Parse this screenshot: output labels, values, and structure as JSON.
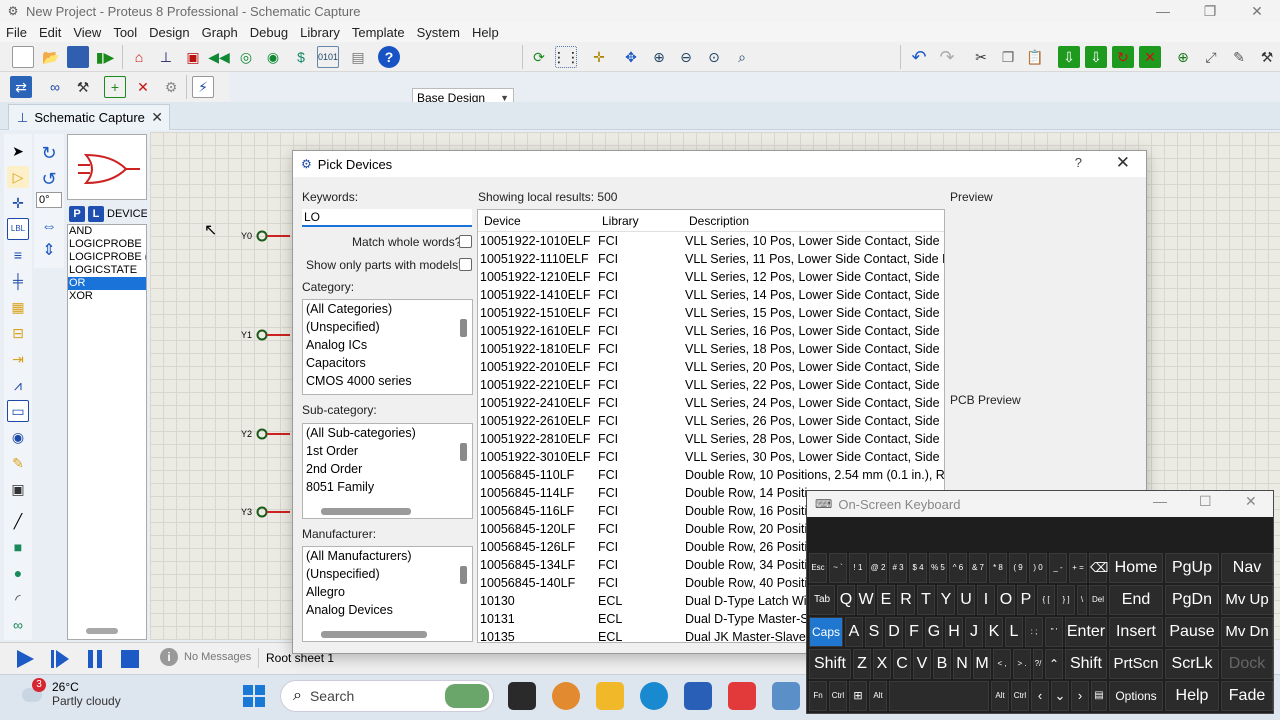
{
  "window": {
    "title": "New Project - Proteus 8 Professional - Schematic Capture"
  },
  "menu": [
    "File",
    "Edit",
    "View",
    "Tool",
    "Design",
    "Graph",
    "Debug",
    "Library",
    "Template",
    "System",
    "Help"
  ],
  "toolbar": {
    "design_select": "Base Design"
  },
  "tab": {
    "label": "Schematic Capture"
  },
  "device_panel": {
    "rotation_value": "0°",
    "header_p": "P",
    "header_l": "L",
    "header_label": "DEVICES",
    "items": [
      "AND",
      "LOGICPROBE",
      "LOGICPROBE (",
      "LOGICSTATE",
      "OR",
      "XOR"
    ],
    "selected_index": 4
  },
  "canvas": {
    "pins": [
      "Y0",
      "Y1",
      "Y2",
      "Y3"
    ]
  },
  "status": {
    "messages": "No Messages",
    "sheet": "Root sheet 1"
  },
  "taskbar": {
    "weather_badge": "3",
    "temperature": "26°C",
    "condition": "Partly cloudy",
    "search_placeholder": "Search"
  },
  "dialog": {
    "title": "Pick Devices",
    "help": "?",
    "keywords_label": "Keywords:",
    "keywords_value": "LO",
    "match_whole_words": "Match whole words?",
    "only_models": "Show only parts with models?",
    "category_label": "Category:",
    "categories": [
      "(All Categories)",
      "(Unspecified)",
      "Analog ICs",
      "Capacitors",
      "CMOS 4000 series"
    ],
    "subcategory_label": "Sub-category:",
    "subcategories": [
      "(All Sub-categories)",
      "1st Order",
      "2nd Order",
      "8051 Family"
    ],
    "manufacturer_label": "Manufacturer:",
    "manufacturers": [
      "(All Manufacturers)",
      "(Unspecified)",
      "Allegro",
      "Analog Devices"
    ],
    "results_label": "Showing local results: 500",
    "columns": [
      "Device",
      "Library",
      "Description"
    ],
    "rows": [
      [
        "10051922-1010ELF",
        "FCI",
        "VLL Series, 10 Pos, Lower Side Contact, Side Ent"
      ],
      [
        "10051922-1110ELF",
        "FCI",
        "VLL Series, 11 Pos, Lower Side Contact, Side Ent"
      ],
      [
        "10051922-1210ELF",
        "FCI",
        "VLL Series, 12 Pos, Lower Side Contact, Side Ent"
      ],
      [
        "10051922-1410ELF",
        "FCI",
        "VLL Series, 14 Pos, Lower Side Contact, Side Ent"
      ],
      [
        "10051922-1510ELF",
        "FCI",
        "VLL Series, 15 Pos, Lower Side Contact, Side Ent"
      ],
      [
        "10051922-1610ELF",
        "FCI",
        "VLL Series, 16 Pos, Lower Side Contact, Side Ent"
      ],
      [
        "10051922-1810ELF",
        "FCI",
        "VLL Series, 18 Pos, Lower Side Contact, Side Ent"
      ],
      [
        "10051922-2010ELF",
        "FCI",
        "VLL Series, 20 Pos, Lower Side Contact, Side Ent"
      ],
      [
        "10051922-2210ELF",
        "FCI",
        "VLL Series, 22 Pos, Lower Side Contact, Side Ent"
      ],
      [
        "10051922-2410ELF",
        "FCI",
        "VLL Series, 24 Pos, Lower Side Contact, Side Ent"
      ],
      [
        "10051922-2610ELF",
        "FCI",
        "VLL Series, 26 Pos, Lower Side Contact, Side Ent"
      ],
      [
        "10051922-2810ELF",
        "FCI",
        "VLL Series, 28 Pos, Lower Side Contact, Side Ent"
      ],
      [
        "10051922-3010ELF",
        "FCI",
        "VLL Series, 30 Pos, Lower Side Contact, Side Ent"
      ],
      [
        "10056845-110LF",
        "FCI",
        "Double Row, 10 Positions, 2.54 mm (0.1 in.), Rig"
      ],
      [
        "10056845-114LF",
        "FCI",
        "Double Row, 14 Positi"
      ],
      [
        "10056845-116LF",
        "FCI",
        "Double Row, 16 Positi"
      ],
      [
        "10056845-120LF",
        "FCI",
        "Double Row, 20 Positi"
      ],
      [
        "10056845-126LF",
        "FCI",
        "Double Row, 26 Positi"
      ],
      [
        "10056845-134LF",
        "FCI",
        "Double Row, 34 Positi"
      ],
      [
        "10056845-140LF",
        "FCI",
        "Double Row, 40 Positi"
      ],
      [
        "10130",
        "ECL",
        "Dual D-Type Latch Wit"
      ],
      [
        "10131",
        "ECL",
        "Dual D-Type Master-S"
      ],
      [
        "10135",
        "ECL",
        "Dual JK Master-Slave F"
      ]
    ],
    "preview_label": "Preview",
    "pcb_preview_label": "PCB Preview"
  },
  "osk": {
    "title": "On-Screen Keyboard",
    "keys": {
      "esc": "Esc",
      "tab": "Tab",
      "caps": "Caps",
      "shift": "Shift",
      "fn": "Fn",
      "ctrl": "Ctrl",
      "alt": "Alt",
      "del": "Del",
      "enter": "Enter",
      "shift_r": "Shift",
      "q": "Q",
      "w": "W",
      "e": "E",
      "r": "R",
      "t": "T",
      "y": "Y",
      "u": "U",
      "i": "I",
      "o": "O",
      "p": "P",
      "a": "A",
      "s": "S",
      "d": "D",
      "f": "F",
      "g": "G",
      "h": "H",
      "j": "J",
      "k": "K",
      "l": "L",
      "z": "Z",
      "x": "X",
      "c": "C",
      "v": "V",
      "b": "B",
      "n": "N",
      "m": "M",
      "home": "Home",
      "pgup": "PgUp",
      "nav": "Nav",
      "end": "End",
      "pgdn": "PgDn",
      "mvup": "Mv Up",
      "insert": "Insert",
      "pause": "Pause",
      "mvdn": "Mv Dn",
      "prtscn": "PrtScn",
      "scrlk": "ScrLk",
      "dock": "Dock",
      "options": "Options",
      "help": "Help",
      "fade": "Fade"
    }
  },
  "colors": {
    "accent_blue": "#1f77d0",
    "selection_blue": "#1a73d9",
    "pin_red": "#c22",
    "wire_green": "#1a5a1a"
  }
}
